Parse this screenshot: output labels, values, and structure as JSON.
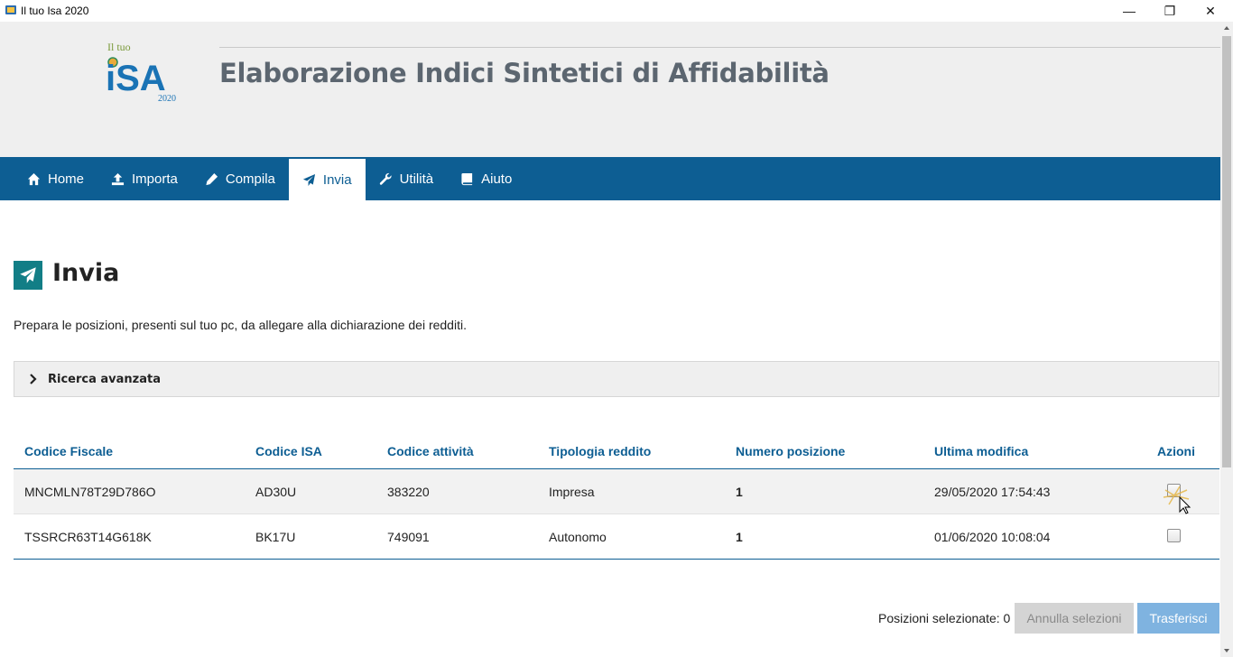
{
  "window": {
    "title": "Il tuo Isa 2020",
    "minimize": "—",
    "maximize": "❐",
    "close": "✕"
  },
  "logo": {
    "line1": "Il tuo",
    "line2": "iSA",
    "year": "2020"
  },
  "header": {
    "title": "Elaborazione Indici Sintetici di Affidabilità"
  },
  "nav": {
    "items": [
      {
        "label": "Home",
        "icon": "home-icon"
      },
      {
        "label": "Importa",
        "icon": "upload-icon"
      },
      {
        "label": "Compila",
        "icon": "pencil-icon"
      },
      {
        "label": "Invia",
        "icon": "paper-plane-icon",
        "active": true
      },
      {
        "label": "Utilità",
        "icon": "wrench-icon"
      },
      {
        "label": "Aiuto",
        "icon": "book-icon"
      }
    ]
  },
  "page": {
    "title": "Invia",
    "description": "Prepara le posizioni, presenti sul tuo pc, da allegare alla dichiarazione dei redditi."
  },
  "advanced_search": {
    "label": "Ricerca avanzata"
  },
  "table": {
    "headers": [
      "Codice Fiscale",
      "Codice ISA",
      "Codice attività",
      "Tipologia reddito",
      "Numero posizione",
      "Ultima modifica",
      "Azioni"
    ],
    "rows": [
      [
        "MNCMLN78T29D786O",
        "AD30U",
        "383220",
        "Impresa",
        "1",
        "29/05/2020 17:54:43"
      ],
      [
        "TSSRCR63T14G618K",
        "BK17U",
        "749091",
        "Autonomo",
        "1",
        "01/06/2020 10:08:04"
      ]
    ]
  },
  "footer": {
    "selected_label": "Posizioni selezionate: 0",
    "cancel_label": "Annulla selezioni",
    "transfer_label": "Trasferisci"
  },
  "colors": {
    "nav_bg": "#0d5e93",
    "accent_teal": "#127e86",
    "header_bg": "#efefef",
    "link_blue": "#0d5e93"
  }
}
